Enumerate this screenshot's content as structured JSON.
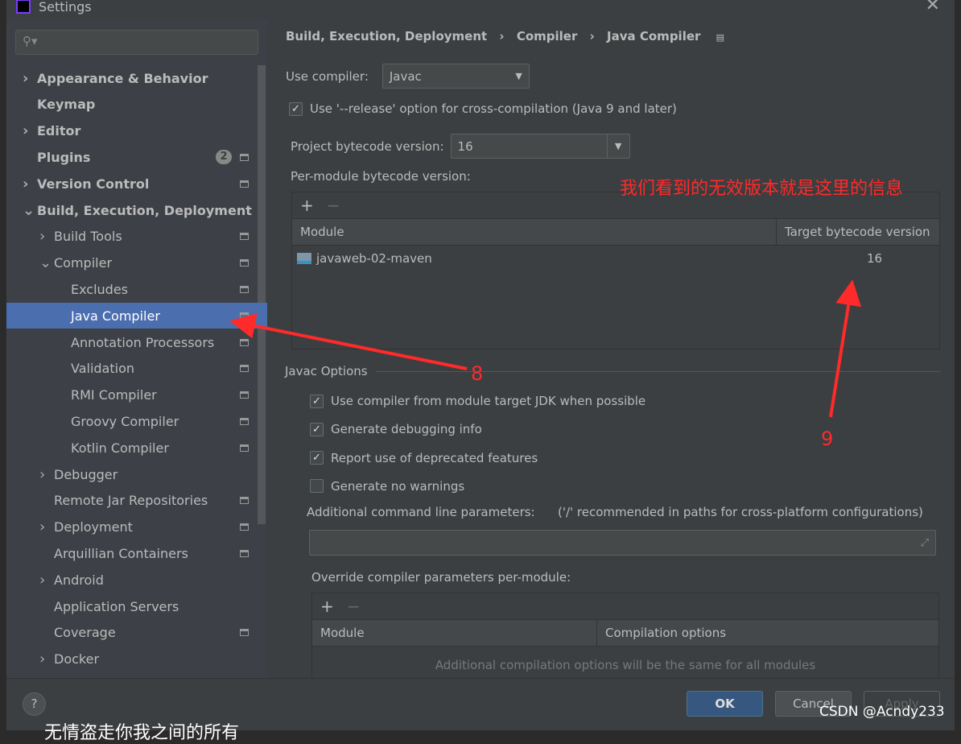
{
  "window": {
    "title": "Settings",
    "close": "✕"
  },
  "sidebar": {
    "search_placeholder": "",
    "items": [
      {
        "label": "Appearance & Behavior",
        "bold": true,
        "chev": ">",
        "indent": 0
      },
      {
        "label": "Keymap",
        "bold": true,
        "indent": 0
      },
      {
        "label": "Editor",
        "bold": true,
        "chev": ">",
        "indent": 0
      },
      {
        "label": "Plugins",
        "bold": true,
        "indent": 0,
        "badge": "2",
        "page": true
      },
      {
        "label": "Version Control",
        "bold": true,
        "chev": ">",
        "indent": 0,
        "page": true
      },
      {
        "label": "Build, Execution, Deployment",
        "bold": true,
        "chev": "v",
        "indent": 0
      },
      {
        "label": "Build Tools",
        "chev": ">",
        "indent": 1,
        "page": true
      },
      {
        "label": "Compiler",
        "chev": "v",
        "indent": 1,
        "page": true
      },
      {
        "label": "Excludes",
        "indent": 2,
        "page": true
      },
      {
        "label": "Java Compiler",
        "indent": 2,
        "page": true,
        "selected": true
      },
      {
        "label": "Annotation Processors",
        "indent": 2,
        "page": true
      },
      {
        "label": "Validation",
        "indent": 2,
        "page": true
      },
      {
        "label": "RMI Compiler",
        "indent": 2,
        "page": true
      },
      {
        "label": "Groovy Compiler",
        "indent": 2,
        "page": true
      },
      {
        "label": "Kotlin Compiler",
        "indent": 2,
        "page": true
      },
      {
        "label": "Debugger",
        "chev": ">",
        "indent": 1
      },
      {
        "label": "Remote Jar Repositories",
        "indent": 1,
        "page": true
      },
      {
        "label": "Deployment",
        "chev": ">",
        "indent": 1,
        "page": true
      },
      {
        "label": "Arquillian Containers",
        "indent": 1,
        "page": true
      },
      {
        "label": "Android",
        "chev": ">",
        "indent": 1
      },
      {
        "label": "Application Servers",
        "indent": 1
      },
      {
        "label": "Coverage",
        "indent": 1,
        "page": true
      },
      {
        "label": "Docker",
        "chev": ">",
        "indent": 1
      }
    ]
  },
  "breadcrumb": [
    "Build, Execution, Deployment",
    "Compiler",
    "Java Compiler"
  ],
  "compiler": {
    "label": "Use compiler:",
    "value": "Javac"
  },
  "release_option": {
    "label": "Use '--release' option for cross-compilation (Java 9 and later)",
    "checked": true
  },
  "bytecode": {
    "label": "Project bytecode version:",
    "value": "16"
  },
  "per_module": {
    "label": "Per-module bytecode version:",
    "add": "+",
    "remove": "−",
    "columns": [
      "Module",
      "Target bytecode version"
    ],
    "rows": [
      {
        "module": "javaweb-02-maven",
        "version": "16"
      }
    ]
  },
  "javac": {
    "title": "Javac Options",
    "options": [
      {
        "label": "Use compiler from module target JDK when possible",
        "checked": true
      },
      {
        "label": "Generate debugging info",
        "checked": true
      },
      {
        "label": "Report use of deprecated features",
        "checked": true
      },
      {
        "label": "Generate no warnings",
        "checked": false
      }
    ],
    "cmd_label": "Additional command line parameters:",
    "cmd_hint": "('/' recommended in paths for cross-platform configurations)",
    "cmd_value": "",
    "override_label": "Override compiler parameters per-module:",
    "override_columns": [
      "Module",
      "Compilation options"
    ],
    "override_empty": "Additional compilation options will be the same for all modules",
    "add": "+",
    "remove": "−"
  },
  "annotations": {
    "note": "我们看到的无效版本就是这里的信息",
    "n8": "8",
    "n9": "9",
    "color": "#ff2a2a"
  },
  "footer": {
    "help": "?",
    "ok": "OK",
    "cancel": "Cancel",
    "apply": "Apply"
  },
  "watermark": "CSDN @Acndy233",
  "subtitle": "无情盗走你我之间的所有"
}
